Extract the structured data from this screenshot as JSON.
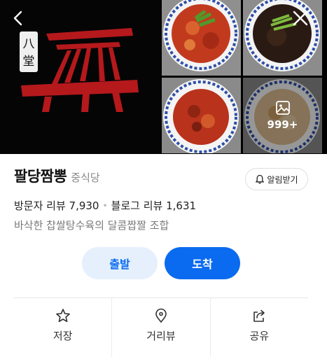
{
  "gallery": {
    "more_count": "999+",
    "logo_text": "八堂"
  },
  "place": {
    "name": "팔당짬뽕",
    "category": "중식당",
    "alarm_label": "알림받기",
    "visitor_reviews": "방문자 리뷰 7,930",
    "blog_reviews": "블로그 리뷰 1,631",
    "description": "바삭한 찹쌀탕수육의 달콤짭짤 조합"
  },
  "route": {
    "depart_label": "출발",
    "arrive_label": "도착"
  },
  "actions": [
    {
      "label": "저장",
      "icon": "star-icon"
    },
    {
      "label": "거리뷰",
      "icon": "map-pin-icon"
    },
    {
      "label": "공유",
      "icon": "share-icon"
    }
  ],
  "colors": {
    "accent": "#0a6bf0",
    "accent_light": "#e5f0fc",
    "logo_red": "#b5191c"
  }
}
